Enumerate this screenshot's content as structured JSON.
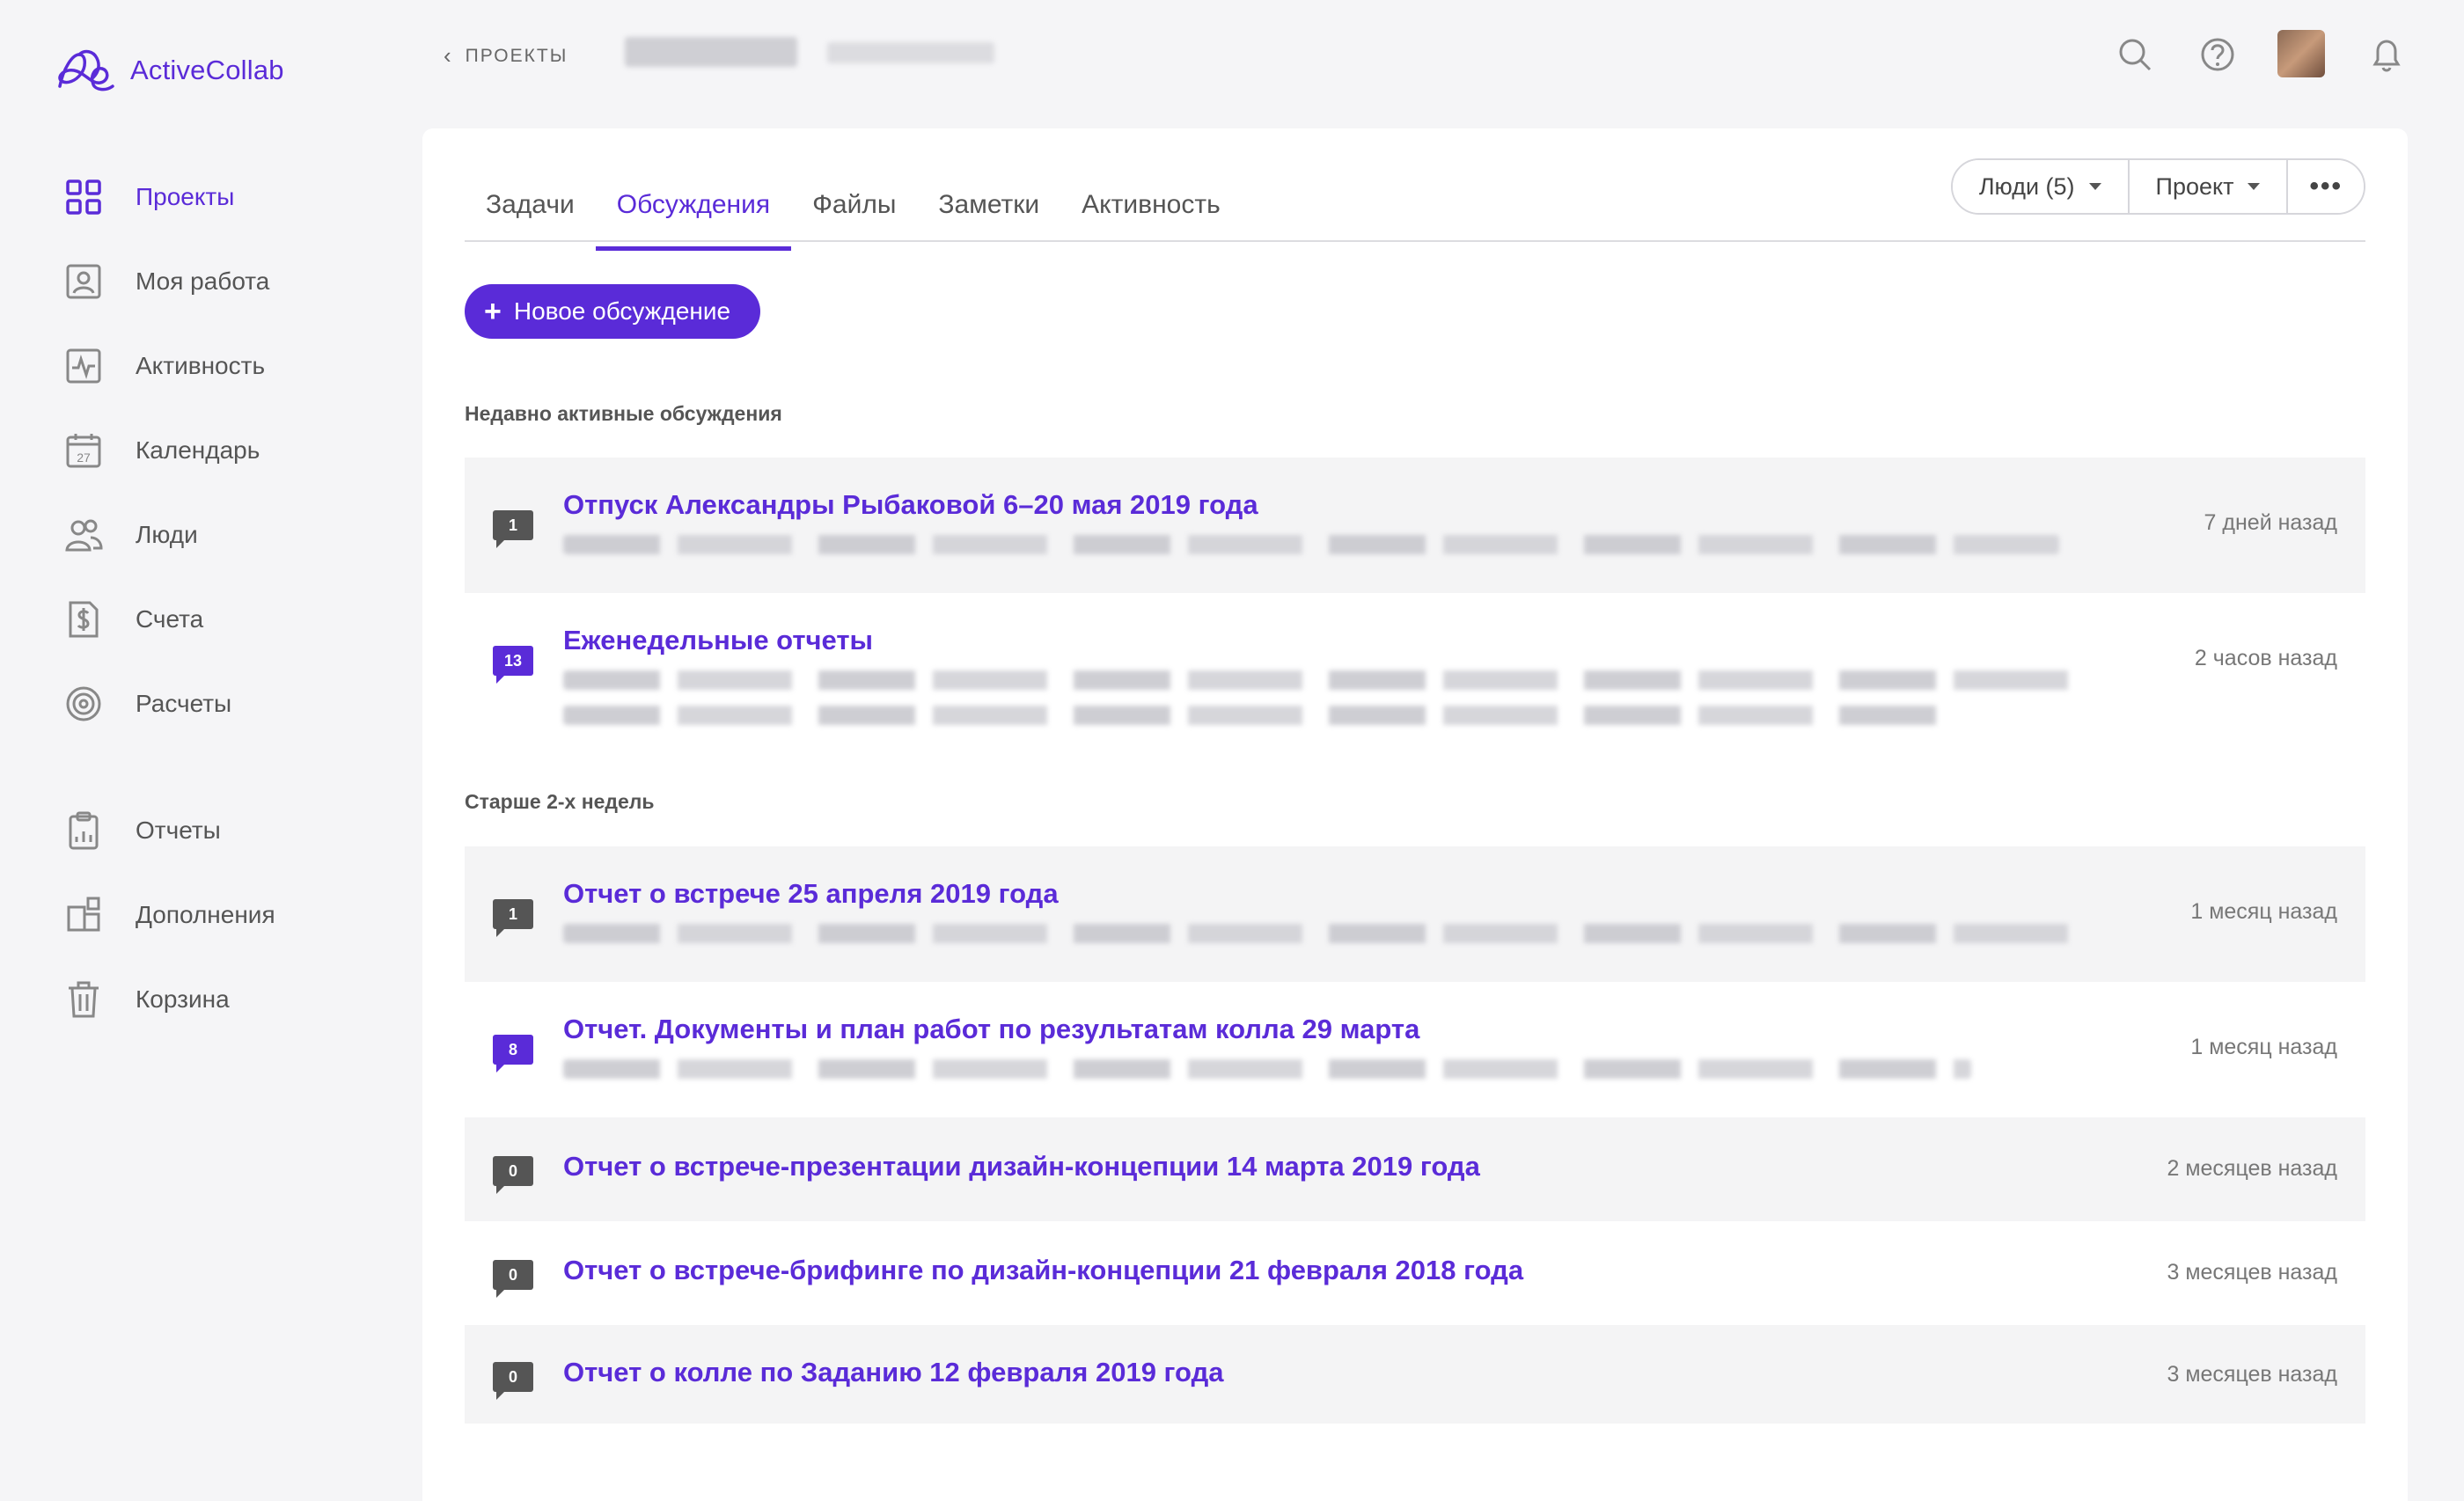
{
  "app": {
    "name": "ActiveCollab",
    "brand_color": "#5a2bd8"
  },
  "sidebar": {
    "items": [
      {
        "label": "Проекты",
        "icon": "grid-icon",
        "active": true
      },
      {
        "label": "Моя работа",
        "icon": "user-card-icon"
      },
      {
        "label": "Активность",
        "icon": "activity-icon"
      },
      {
        "label": "Календарь",
        "icon": "calendar-icon",
        "day": "27"
      },
      {
        "label": "Люди",
        "icon": "people-icon"
      },
      {
        "label": "Счета",
        "icon": "invoice-icon"
      },
      {
        "label": "Расчеты",
        "icon": "target-icon"
      },
      {
        "label": "Отчеты",
        "icon": "clipboard-icon"
      },
      {
        "label": "Дополнения",
        "icon": "addons-icon"
      },
      {
        "label": "Корзина",
        "icon": "trash-icon"
      }
    ]
  },
  "topbar": {
    "back_label": "ПРОЕКТЫ",
    "icons": [
      "search-icon",
      "help-icon",
      "avatar",
      "bell-icon"
    ]
  },
  "tabs": [
    {
      "label": "Задачи"
    },
    {
      "label": "Обсуждения",
      "active": true
    },
    {
      "label": "Файлы"
    },
    {
      "label": "Заметки"
    },
    {
      "label": "Активность"
    }
  ],
  "toolbar": {
    "people_label": "Люди (5)",
    "project_label": "Проект",
    "more_label": "•••"
  },
  "new_button": {
    "plus": "+",
    "label": "Новое обсуждение"
  },
  "sections": {
    "recent": "Недавно активные обсуждения",
    "older": "Старше 2-х недель"
  },
  "discussions": {
    "recent": [
      {
        "count": "1",
        "title": "Отпуск Александры Рыбаковой 6–20 мая 2019 года",
        "time": "7 дней назад"
      },
      {
        "count": "13",
        "title": "Еженедельные отчеты",
        "time": "2 часов назад",
        "unread": true
      }
    ],
    "older": [
      {
        "count": "1",
        "title": "Отчет о встрече 25 апреля 2019 года",
        "time": "1 месяц назад"
      },
      {
        "count": "8",
        "title": "Отчет. Документы и план работ по результатам колла 29 марта",
        "time": "1 месяц назад",
        "unread": true
      },
      {
        "count": "0",
        "title": "Отчет о встрече-презентации дизайн-концепции 14 марта 2019 года",
        "time": "2 месяцев назад"
      },
      {
        "count": "0",
        "title": "Отчет о встрече-брифинге по дизайн-концепции 21 февраля 2018 года",
        "time": "3 месяцев назад"
      },
      {
        "count": "0",
        "title": "Отчет о колле по Заданию 12 февраля 2019 года",
        "time": "3 месяцев назад"
      }
    ]
  }
}
